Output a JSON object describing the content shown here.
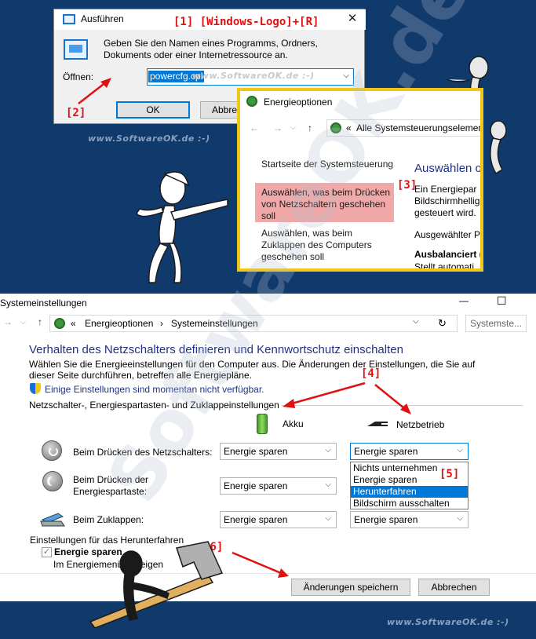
{
  "annotations": {
    "step1": "[1] [Windows-Logo]+[R]",
    "step2": "[2]",
    "step3": "[3]",
    "step4": "[4]",
    "step5": "[5]",
    "step6": "[6]"
  },
  "watermarks": {
    "site": "www.SoftwareOK.de :-)",
    "big": "SoftwareOK.de"
  },
  "run_dialog": {
    "title": "Ausführen",
    "close": "✕",
    "description": "Geben Sie den Namen eines Programms, Ordners, Dokuments oder einer Internetressource an.",
    "open_label": "Öffnen:",
    "input_value": "powercfg.cpl",
    "ok_label": "OK",
    "cancel_label": "Abbre"
  },
  "energy_options": {
    "title": "Energieoptionen",
    "breadcrumb": "Alle Systemsteuerungselement",
    "sidebar": [
      "Startseite der Systemsteuerung",
      "Auswählen, was beim Drücken von Netzschaltern geschehen soll",
      "Auswählen, was beim Zuklappen des Computers geschehen soll"
    ],
    "main_heading": "Auswählen o",
    "main_text": "Ein Energiepar Bildschirmhellig gesteuert wird.",
    "selected_label": "Ausgewählter P",
    "plan_bold": "Ausbalanciert (",
    "plan_sub": "Stellt automati"
  },
  "system_settings": {
    "title": "Systemeinstellungen",
    "minimize": "—",
    "maximize": "☐",
    "close": "✕",
    "breadcrumb": {
      "root": "Energieoptionen",
      "current": "Systemeinstellungen"
    },
    "search_placeholder": "Systemste...",
    "heading": "Verhalten des Netzschalters definieren und Kennwortschutz einschalten",
    "description": "Wählen Sie die Energieeinstellungen für den Computer aus. Die Änderungen der Einstellungen, die Sie auf dieser Seite durchführen, betreffen alle Energiepläne.",
    "unavailable_link": "Einige Einstellungen sind momentan nicht verfügbar.",
    "section_title": "Netzschalter-, Energiespartasten- und Zuklappeinstellungen",
    "col_battery": "Akku",
    "col_ac": "Netzbetrieb",
    "rows": [
      {
        "label": "Beim Drücken des Netzschalters:",
        "battery": "Energie sparen",
        "ac": "Energie sparen"
      },
      {
        "label": "Beim Drücken der Energiespartaste:",
        "battery": "Energie sparen",
        "ac": ""
      },
      {
        "label": "Beim Zuklappen:",
        "battery": "Energie sparen",
        "ac": "Energie sparen"
      }
    ],
    "dropdown_options": [
      "Nichts unternehmen",
      "Energie sparen",
      "Herunterfahren",
      "Bildschirm ausschalten"
    ],
    "dropdown_selected_index": 2,
    "shutdown_section": "Einstellungen für das Herunterfahren",
    "checkbox_label": "Energie sparen",
    "checkbox_sub": "Im Energiemenü anzeigen",
    "save_button": "Änderungen speichern",
    "cancel_button": "Abbrechen"
  },
  "colors": {
    "background": "#113a6c",
    "annotation_red": "#e01010",
    "frame_yellow": "#f3c514",
    "link_blue": "#1e3287",
    "selection_blue": "#0078d7"
  }
}
